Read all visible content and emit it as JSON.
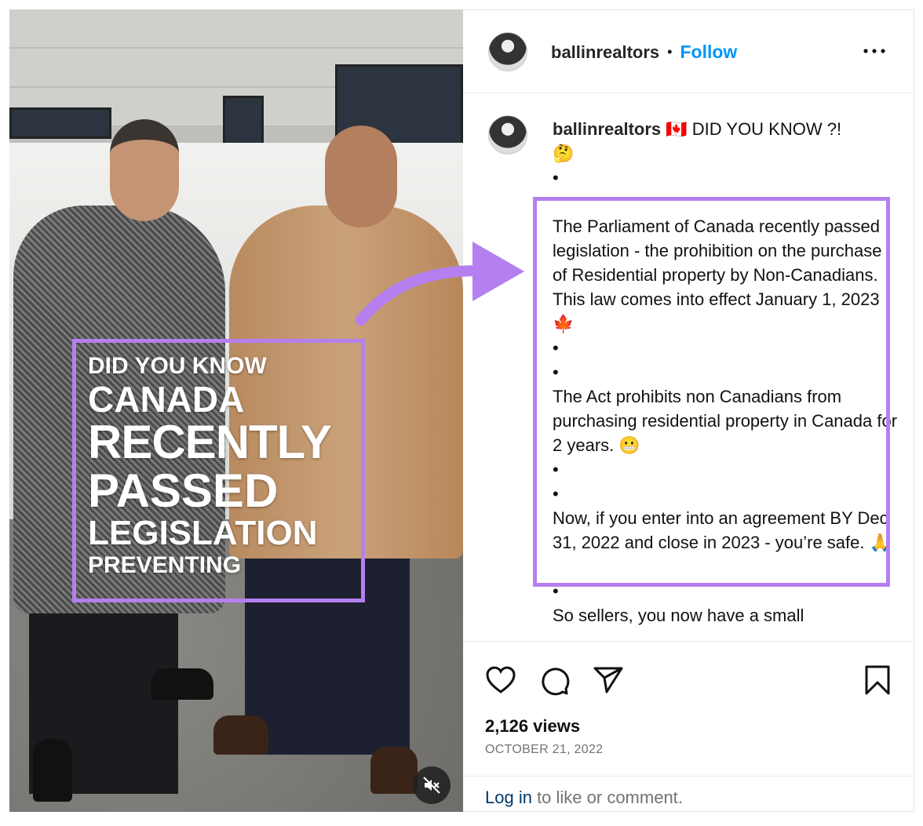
{
  "post": {
    "username": "ballinrealtors",
    "follow_label": "Follow",
    "separator": "•",
    "more_icon": "more-horizontal-icon"
  },
  "video_overlay": {
    "lines": [
      "DID YOU KNOW",
      "CANADA",
      "RECENTLY",
      "PASSED",
      "LEGISLATION",
      "PREVENTING"
    ],
    "mute_icon": "speaker-muted-icon"
  },
  "caption": {
    "first_line": "🇨🇦 DID YOU KNOW ?!",
    "emoji": "🤔",
    "bullet": "•",
    "para1": "The Parliament of Canada recently passed legislation - the prohibition on the purchase of Residential property by Non-Canadians. This law comes into effect January 1, 2023 🍁",
    "para2": "The Act prohibits non Canadians from purchasing residential property in Canada for 2 years. 😬",
    "para3": "Now, if you enter into an agreement BY Dec 31, 2022 and close in 2023 - you’re safe. 🙏",
    "para4": "So sellers, you now have a small"
  },
  "actions": {
    "like": "heart-icon",
    "comment": "comment-icon",
    "share": "send-icon",
    "save": "bookmark-icon"
  },
  "stats": {
    "views": "2,126 views",
    "date": "OCTOBER 21, 2022"
  },
  "login": {
    "link": "Log in",
    "text": " to like or comment."
  },
  "colors": {
    "annotation": "#b57ff0",
    "follow": "#0095f6",
    "login_link": "#00376b"
  }
}
